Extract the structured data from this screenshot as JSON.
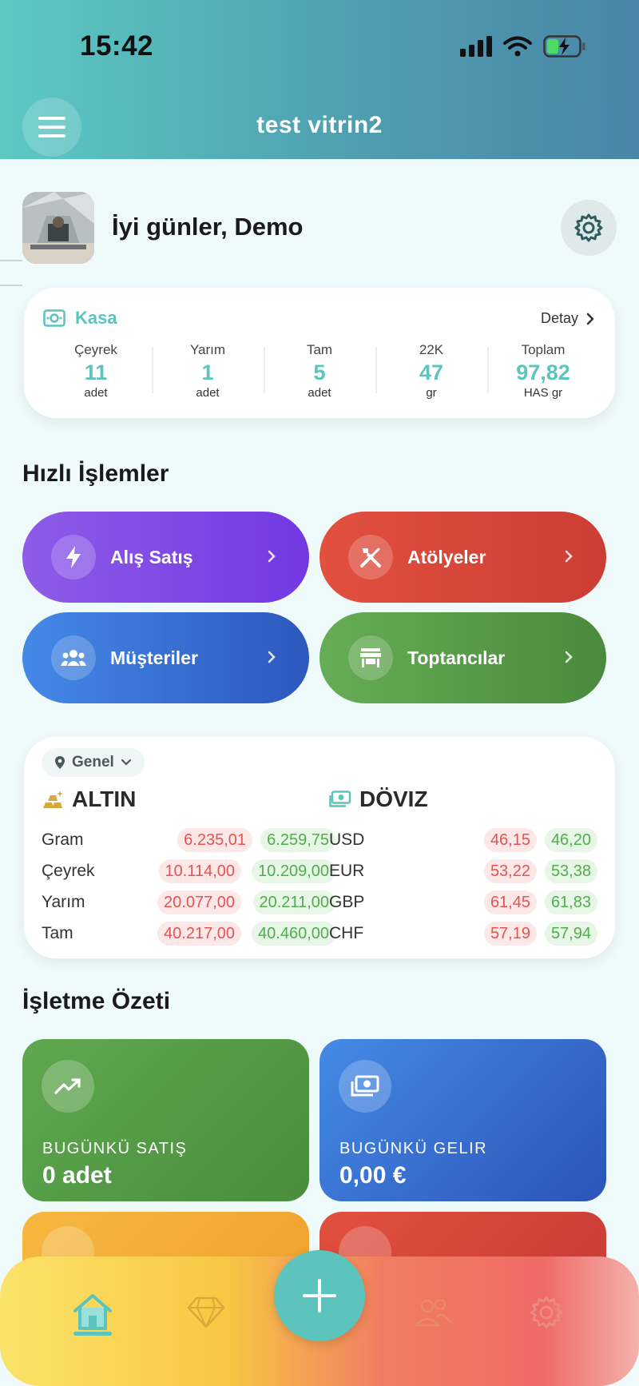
{
  "status_bar": {
    "time": "15:42"
  },
  "header": {
    "title": "test vitrin2"
  },
  "greeting": {
    "text": "İyi günler, Demo"
  },
  "kasa": {
    "title": "Kasa",
    "detail_label": "Detay",
    "stats": [
      {
        "label": "Çeyrek",
        "value": "11",
        "unit": "adet"
      },
      {
        "label": "Yarım",
        "value": "1",
        "unit": "adet"
      },
      {
        "label": "Tam",
        "value": "5",
        "unit": "adet"
      },
      {
        "label": "22K",
        "value": "47",
        "unit": "gr"
      },
      {
        "label": "Toplam",
        "value": "97,82",
        "unit": "HAS gr"
      }
    ]
  },
  "quick_actions": {
    "title": "Hızlı İşlemler",
    "items": [
      {
        "label": "Alış Satış",
        "icon": "bolt-icon"
      },
      {
        "label": "Atölyeler",
        "icon": "tools-icon"
      },
      {
        "label": "Müşteriler",
        "icon": "users-icon"
      },
      {
        "label": "Toptancılar",
        "icon": "store-icon"
      }
    ]
  },
  "market": {
    "region": "Genel",
    "gold": {
      "title": "ALTIN",
      "rows": [
        {
          "name": "Gram",
          "buy": "6.235,01",
          "sell": "6.259,75"
        },
        {
          "name": "Çeyrek",
          "buy": "10.114,00",
          "sell": "10.209,00"
        },
        {
          "name": "Yarım",
          "buy": "20.077,00",
          "sell": "20.211,00"
        },
        {
          "name": "Tam",
          "buy": "40.217,00",
          "sell": "40.460,00"
        }
      ]
    },
    "currency": {
      "title": "DÖVIZ",
      "rows": [
        {
          "name": "USD",
          "buy": "46,15",
          "sell": "46,20"
        },
        {
          "name": "EUR",
          "buy": "53,22",
          "sell": "53,38"
        },
        {
          "name": "GBP",
          "buy": "61,45",
          "sell": "61,83"
        },
        {
          "name": "CHF",
          "buy": "57,19",
          "sell": "57,94"
        }
      ]
    }
  },
  "summary": {
    "title": "İşletme Özeti",
    "cards": [
      {
        "label": "BUGÜNKÜ SATIŞ",
        "value": "0 adet",
        "icon": "trending-up-icon"
      },
      {
        "label": "BUGÜNKÜ GELIR",
        "value": "0,00 €",
        "icon": "money-icon"
      }
    ]
  },
  "colors": {
    "accent": "#5cc4bd",
    "purple": "#7a45e6",
    "red": "#de4c3e",
    "blue": "#3a6fd8",
    "green": "#4f9e44",
    "price_down": "#e55353",
    "price_up": "#4fae4c"
  }
}
